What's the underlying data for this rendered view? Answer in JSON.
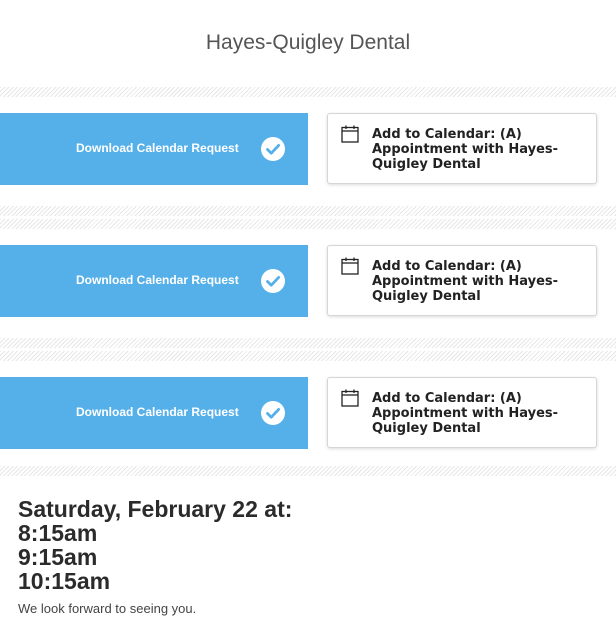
{
  "header": {
    "title": "Hayes-Quigley Dental"
  },
  "colors": {
    "download_button_bg": "#55b0ea",
    "divider_stripe": "#e7e7e7",
    "heading_text": "#2b2b2b"
  },
  "appointments": [
    {
      "download_label": "Download Calendar Request",
      "download_icon": "check-circle-icon",
      "calendar_label": "Add to Calendar: (A) Appointment with Hayes-Quigley Dental",
      "calendar_icon": "calendar-icon"
    },
    {
      "download_label": "Download Calendar Request",
      "download_icon": "check-circle-icon",
      "calendar_label": "Add to Calendar: (A) Appointment with Hayes-Quigley Dental",
      "calendar_icon": "calendar-icon"
    },
    {
      "download_label": "Download Calendar Request",
      "download_icon": "check-circle-icon",
      "calendar_label": "Add to Calendar: (A) Appointment with Hayes-Quigley Dental",
      "calendar_icon": "calendar-icon"
    }
  ],
  "summary": {
    "date_line": "Saturday, February 22 at:",
    "times": [
      "8:15am",
      "9:15am",
      "10:15am"
    ],
    "closing": "We look forward to seeing you."
  }
}
